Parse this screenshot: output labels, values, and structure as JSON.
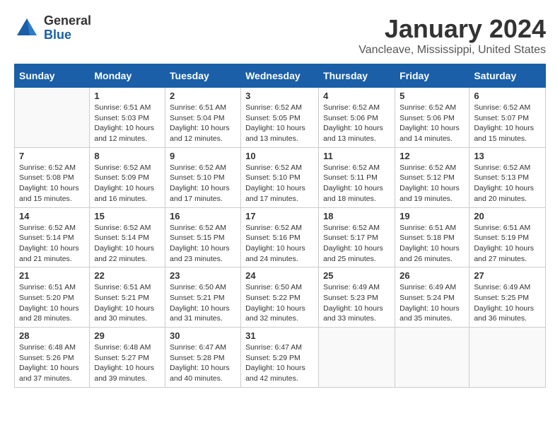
{
  "logo": {
    "general": "General",
    "blue": "Blue"
  },
  "title": "January 2024",
  "location": "Vancleave, Mississippi, United States",
  "headers": [
    "Sunday",
    "Monday",
    "Tuesday",
    "Wednesday",
    "Thursday",
    "Friday",
    "Saturday"
  ],
  "weeks": [
    [
      {
        "day": "",
        "info": ""
      },
      {
        "day": "1",
        "info": "Sunrise: 6:51 AM\nSunset: 5:03 PM\nDaylight: 10 hours\nand 12 minutes."
      },
      {
        "day": "2",
        "info": "Sunrise: 6:51 AM\nSunset: 5:04 PM\nDaylight: 10 hours\nand 12 minutes."
      },
      {
        "day": "3",
        "info": "Sunrise: 6:52 AM\nSunset: 5:05 PM\nDaylight: 10 hours\nand 13 minutes."
      },
      {
        "day": "4",
        "info": "Sunrise: 6:52 AM\nSunset: 5:06 PM\nDaylight: 10 hours\nand 13 minutes."
      },
      {
        "day": "5",
        "info": "Sunrise: 6:52 AM\nSunset: 5:06 PM\nDaylight: 10 hours\nand 14 minutes."
      },
      {
        "day": "6",
        "info": "Sunrise: 6:52 AM\nSunset: 5:07 PM\nDaylight: 10 hours\nand 15 minutes."
      }
    ],
    [
      {
        "day": "7",
        "info": "Sunrise: 6:52 AM\nSunset: 5:08 PM\nDaylight: 10 hours\nand 15 minutes."
      },
      {
        "day": "8",
        "info": "Sunrise: 6:52 AM\nSunset: 5:09 PM\nDaylight: 10 hours\nand 16 minutes."
      },
      {
        "day": "9",
        "info": "Sunrise: 6:52 AM\nSunset: 5:10 PM\nDaylight: 10 hours\nand 17 minutes."
      },
      {
        "day": "10",
        "info": "Sunrise: 6:52 AM\nSunset: 5:10 PM\nDaylight: 10 hours\nand 17 minutes."
      },
      {
        "day": "11",
        "info": "Sunrise: 6:52 AM\nSunset: 5:11 PM\nDaylight: 10 hours\nand 18 minutes."
      },
      {
        "day": "12",
        "info": "Sunrise: 6:52 AM\nSunset: 5:12 PM\nDaylight: 10 hours\nand 19 minutes."
      },
      {
        "day": "13",
        "info": "Sunrise: 6:52 AM\nSunset: 5:13 PM\nDaylight: 10 hours\nand 20 minutes."
      }
    ],
    [
      {
        "day": "14",
        "info": "Sunrise: 6:52 AM\nSunset: 5:14 PM\nDaylight: 10 hours\nand 21 minutes."
      },
      {
        "day": "15",
        "info": "Sunrise: 6:52 AM\nSunset: 5:14 PM\nDaylight: 10 hours\nand 22 minutes."
      },
      {
        "day": "16",
        "info": "Sunrise: 6:52 AM\nSunset: 5:15 PM\nDaylight: 10 hours\nand 23 minutes."
      },
      {
        "day": "17",
        "info": "Sunrise: 6:52 AM\nSunset: 5:16 PM\nDaylight: 10 hours\nand 24 minutes."
      },
      {
        "day": "18",
        "info": "Sunrise: 6:52 AM\nSunset: 5:17 PM\nDaylight: 10 hours\nand 25 minutes."
      },
      {
        "day": "19",
        "info": "Sunrise: 6:51 AM\nSunset: 5:18 PM\nDaylight: 10 hours\nand 26 minutes."
      },
      {
        "day": "20",
        "info": "Sunrise: 6:51 AM\nSunset: 5:19 PM\nDaylight: 10 hours\nand 27 minutes."
      }
    ],
    [
      {
        "day": "21",
        "info": "Sunrise: 6:51 AM\nSunset: 5:20 PM\nDaylight: 10 hours\nand 28 minutes."
      },
      {
        "day": "22",
        "info": "Sunrise: 6:51 AM\nSunset: 5:21 PM\nDaylight: 10 hours\nand 30 minutes."
      },
      {
        "day": "23",
        "info": "Sunrise: 6:50 AM\nSunset: 5:21 PM\nDaylight: 10 hours\nand 31 minutes."
      },
      {
        "day": "24",
        "info": "Sunrise: 6:50 AM\nSunset: 5:22 PM\nDaylight: 10 hours\nand 32 minutes."
      },
      {
        "day": "25",
        "info": "Sunrise: 6:49 AM\nSunset: 5:23 PM\nDaylight: 10 hours\nand 33 minutes."
      },
      {
        "day": "26",
        "info": "Sunrise: 6:49 AM\nSunset: 5:24 PM\nDaylight: 10 hours\nand 35 minutes."
      },
      {
        "day": "27",
        "info": "Sunrise: 6:49 AM\nSunset: 5:25 PM\nDaylight: 10 hours\nand 36 minutes."
      }
    ],
    [
      {
        "day": "28",
        "info": "Sunrise: 6:48 AM\nSunset: 5:26 PM\nDaylight: 10 hours\nand 37 minutes."
      },
      {
        "day": "29",
        "info": "Sunrise: 6:48 AM\nSunset: 5:27 PM\nDaylight: 10 hours\nand 39 minutes."
      },
      {
        "day": "30",
        "info": "Sunrise: 6:47 AM\nSunset: 5:28 PM\nDaylight: 10 hours\nand 40 minutes."
      },
      {
        "day": "31",
        "info": "Sunrise: 6:47 AM\nSunset: 5:29 PM\nDaylight: 10 hours\nand 42 minutes."
      },
      {
        "day": "",
        "info": ""
      },
      {
        "day": "",
        "info": ""
      },
      {
        "day": "",
        "info": ""
      }
    ]
  ]
}
